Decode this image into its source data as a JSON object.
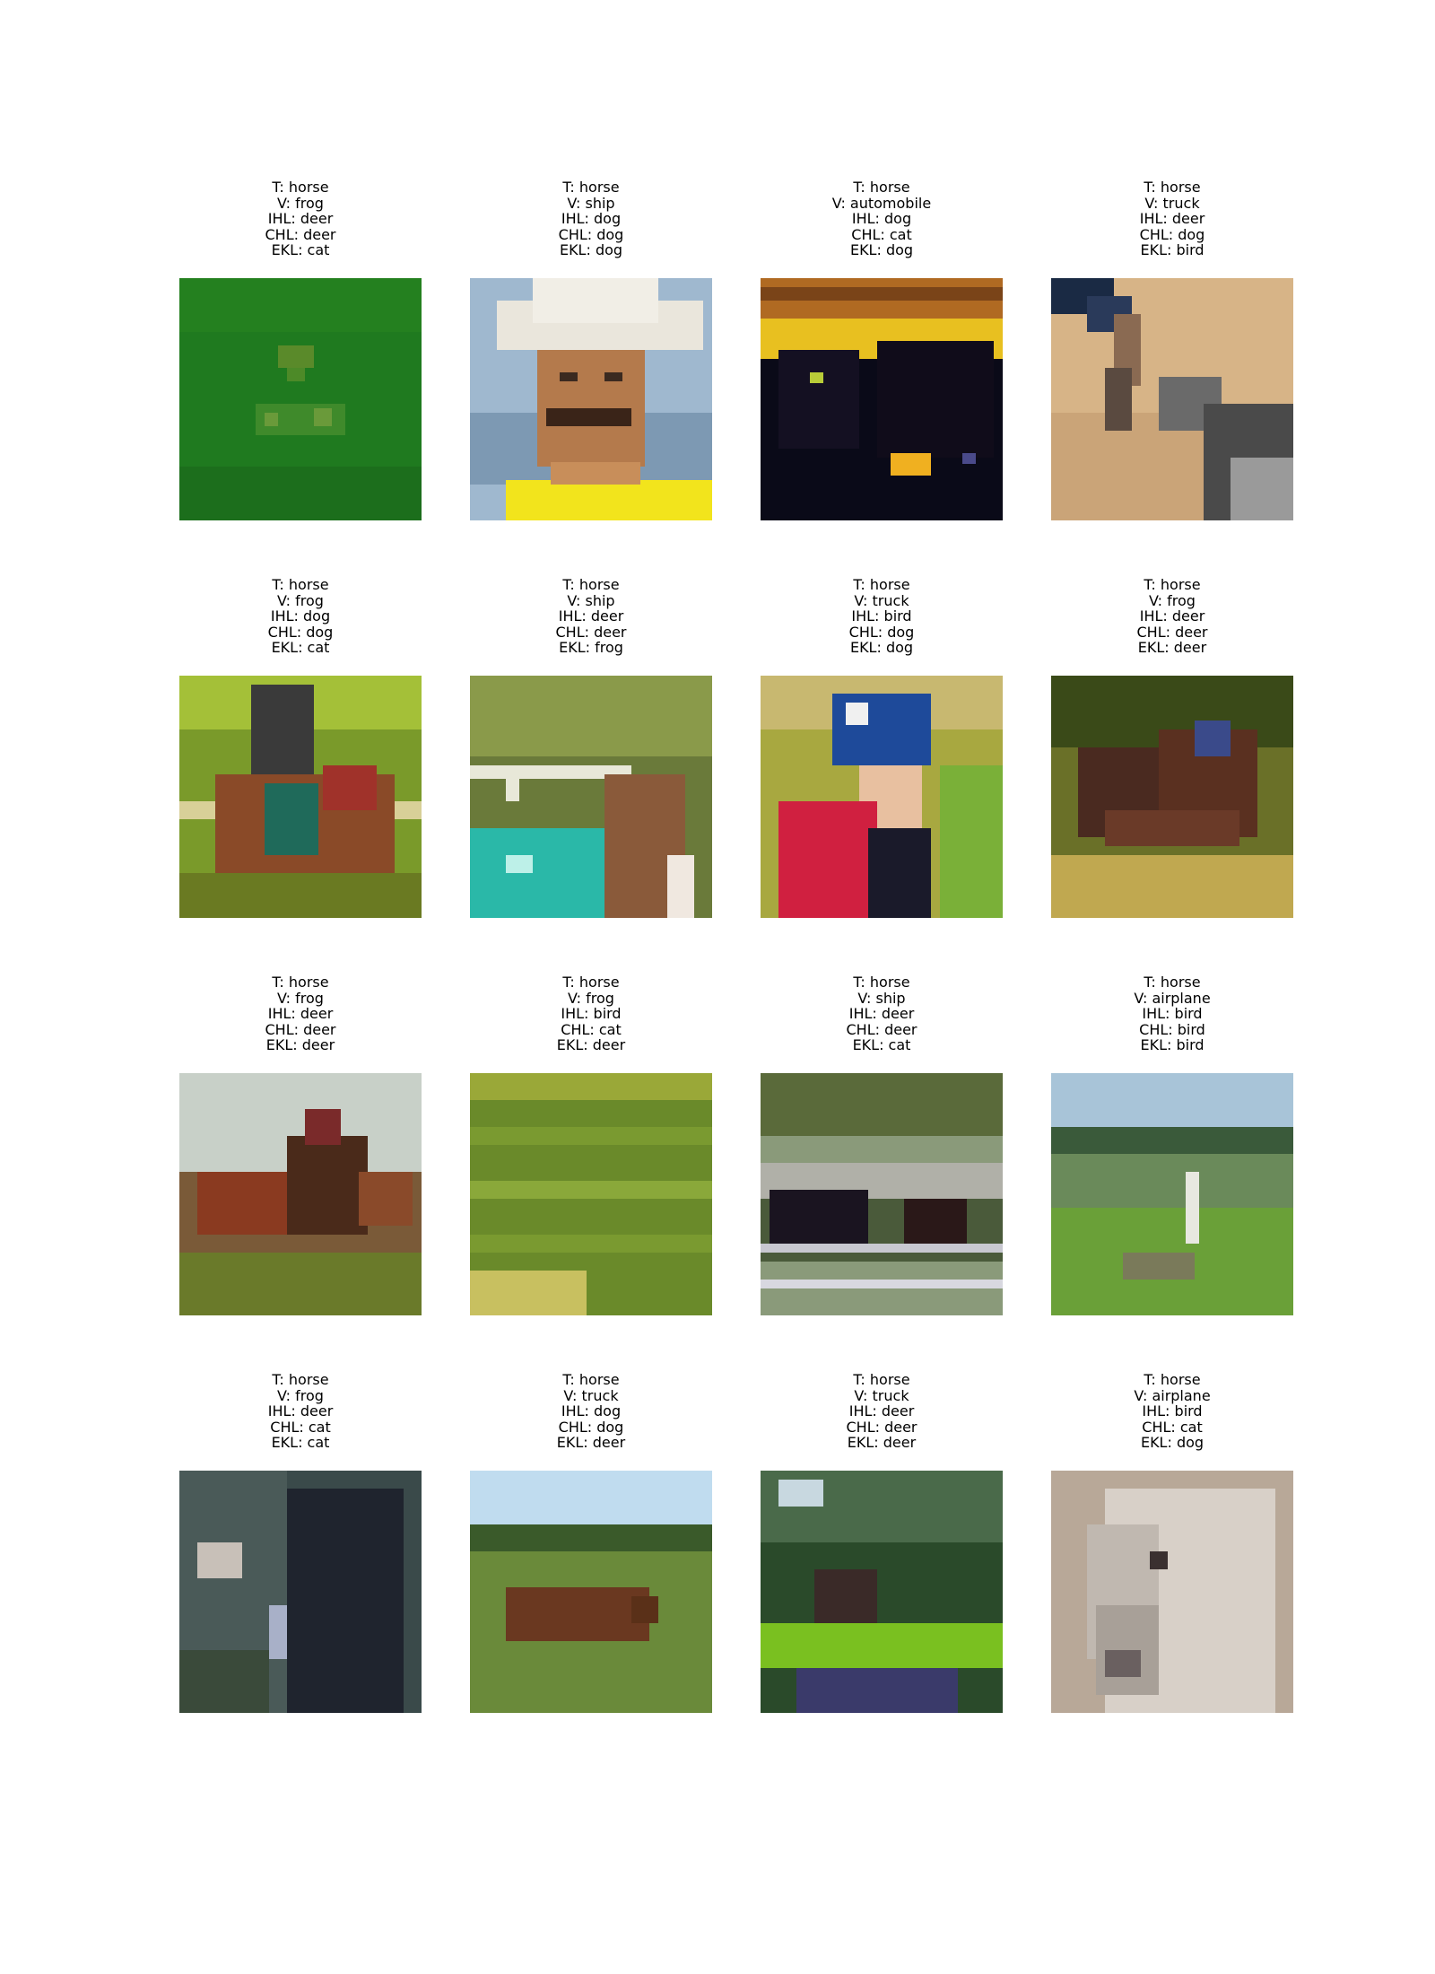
{
  "grid": {
    "items": [
      {
        "t": "T: horse",
        "v": "V: frog",
        "ihl": "IHL: deer",
        "chl": "CHL: deer",
        "ekl": "EKL: cat",
        "image": "green-textured-image"
      },
      {
        "t": "T: horse",
        "v": "V: ship",
        "ihl": "IHL: dog",
        "chl": "CHL: dog",
        "ekl": "EKL: dog",
        "image": "man-in-white-hat-image"
      },
      {
        "t": "T: horse",
        "v": "V: automobile",
        "ihl": "IHL: dog",
        "chl": "CHL: cat",
        "ekl": "EKL: dog",
        "image": "dark-horse-silhouette-image"
      },
      {
        "t": "T: horse",
        "v": "V: truck",
        "ihl": "IHL: deer",
        "chl": "CHL: dog",
        "ekl": "EKL: bird",
        "image": "hand-with-horse-image"
      },
      {
        "t": "T: horse",
        "v": "V: frog",
        "ihl": "IHL: dog",
        "chl": "CHL: dog",
        "ekl": "EKL: cat",
        "image": "rider-on-horse-image"
      },
      {
        "t": "T: horse",
        "v": "V: ship",
        "ihl": "IHL: deer",
        "chl": "CHL: deer",
        "ekl": "EKL: frog",
        "image": "horse-by-fence-image"
      },
      {
        "t": "T: horse",
        "v": "V: truck",
        "ihl": "IHL: bird",
        "chl": "CHL: dog",
        "ekl": "EKL: dog",
        "image": "jockey-blue-helmet-image"
      },
      {
        "t": "T: horse",
        "v": "V: frog",
        "ihl": "IHL: deer",
        "chl": "CHL: deer",
        "ekl": "EKL: deer",
        "image": "horses-in-brush-image"
      },
      {
        "t": "T: horse",
        "v": "V: frog",
        "ihl": "IHL: deer",
        "chl": "CHL: deer",
        "ekl": "EKL: deer",
        "image": "horses-running-image"
      },
      {
        "t": "T: horse",
        "v": "V: frog",
        "ihl": "IHL: bird",
        "chl": "CHL: cat",
        "ekl": "EKL: deer",
        "image": "green-field-image"
      },
      {
        "t": "T: horse",
        "v": "V: ship",
        "ihl": "IHL: deer",
        "chl": "CHL: deer",
        "ekl": "EKL: cat",
        "image": "horses-behind-fence-image"
      },
      {
        "t": "T: horse",
        "v": "V: airplane",
        "ihl": "IHL: bird",
        "chl": "CHL: bird",
        "ekl": "EKL: bird",
        "image": "pasture-landscape-image"
      },
      {
        "t": "T: horse",
        "v": "V: frog",
        "ihl": "IHL: deer",
        "chl": "CHL: cat",
        "ekl": "EKL: cat",
        "image": "dark-horse-in-woods-image"
      },
      {
        "t": "T: horse",
        "v": "V: truck",
        "ihl": "IHL: dog",
        "chl": "CHL: dog",
        "ekl": "EKL: deer",
        "image": "horse-lying-in-field-image"
      },
      {
        "t": "T: horse",
        "v": "V: truck",
        "ihl": "IHL: deer",
        "chl": "CHL: deer",
        "ekl": "EKL: deer",
        "image": "horse-in-foliage-image"
      },
      {
        "t": "T: horse",
        "v": "V: airplane",
        "ihl": "IHL: bird",
        "chl": "CHL: cat",
        "ekl": "EKL: dog",
        "image": "white-horse-head-image"
      }
    ]
  }
}
